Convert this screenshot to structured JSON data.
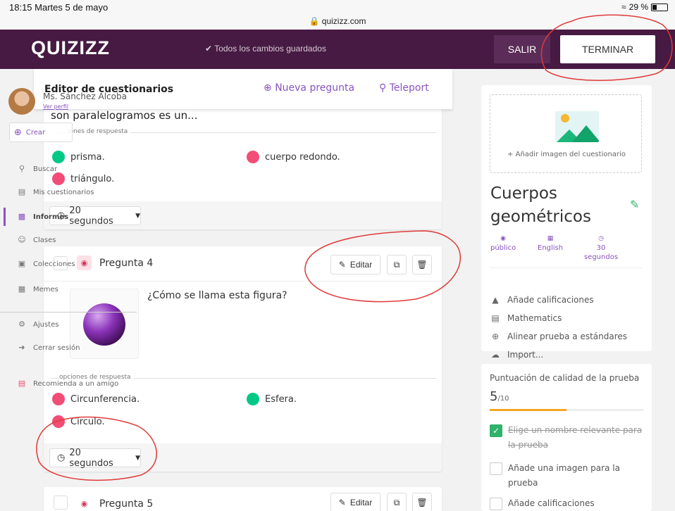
{
  "status_bar": {
    "time": "18:15  Martes 5 de mayo",
    "url": "quizizz.com",
    "battery": "29 %"
  },
  "header": {
    "logo": "QUIZIZZ",
    "saved_status": "Todos los cambios guardados",
    "salir_label": "SALIR",
    "terminar_label": "TERMINAR"
  },
  "editor_bar": {
    "title": "Editor de cuestionarios",
    "nueva_pregunta": "Nueva pregunta",
    "teleport": "Teleport"
  },
  "sidebar": {
    "profile_name": "Ms. Sánchez Alcoba",
    "profile_link": "Ver perfil",
    "crear_label": "Crear",
    "items": [
      {
        "label": "Buscar",
        "icon": "search-icon"
      },
      {
        "label": "Mis cuestionarios",
        "icon": "document-icon"
      },
      {
        "label": "Informes",
        "icon": "bar-chart-icon"
      },
      {
        "label": "Clases",
        "icon": "users-icon"
      },
      {
        "label": "Colecciones",
        "icon": "folder-icon"
      },
      {
        "label": "Memes",
        "icon": "image-icon"
      },
      {
        "label": "Ajustes",
        "icon": "gear-icon"
      },
      {
        "label": "Cerrar sesión",
        "icon": "logout-icon"
      },
      {
        "label": "Recomienda a un amigo",
        "icon": "gift-icon"
      }
    ]
  },
  "question3": {
    "text": "son paralelogramos es un...",
    "options_heading": "iones de respuesta",
    "options": [
      {
        "label": "prisma.",
        "correct": true
      },
      {
        "label": "cuerpo redondo.",
        "correct": false
      },
      {
        "label": "triángulo.",
        "correct": false
      }
    ],
    "time": "20 segundos"
  },
  "question4": {
    "label": "Pregunta 4",
    "text": "¿Cómo se llama esta figura?",
    "edit_label": "Editar",
    "options_heading": "opciones de respuesta",
    "options": [
      {
        "label": "Circunferencia.",
        "correct": false
      },
      {
        "label": "Esfera.",
        "correct": true
      },
      {
        "label": "Círculo.",
        "correct": false
      }
    ],
    "time": "20 segundos"
  },
  "question5": {
    "label": "Pregunta 5",
    "edit_label": "Editar"
  },
  "quiz_panel": {
    "add_image_label": "+ Añadir imagen del cuestionario",
    "title": "Cuerpos geométricos",
    "meta": [
      {
        "label": "público",
        "icon": "eye-icon"
      },
      {
        "label": "English",
        "icon": "language-icon"
      },
      {
        "label": "30 segundos",
        "icon": "clock-icon"
      }
    ],
    "links": [
      {
        "label": "Añade calificaciones",
        "icon": "graduation-cap-icon"
      },
      {
        "label": "Mathematics",
        "icon": "book-icon"
      },
      {
        "label": "Alinear prueba a estándares",
        "icon": "plus-circle-icon"
      },
      {
        "label": "Import...",
        "icon": "cloud-upload-icon"
      }
    ]
  },
  "quality_panel": {
    "label": "Puntuación de calidad de la prueba",
    "score": "5",
    "score_max": "/10",
    "progress_fraction": 0.5,
    "checklist": [
      {
        "label": "Elige un nombre relevante para la prueba",
        "done": true
      },
      {
        "label": "Añade una imagen para la prueba",
        "done": false
      },
      {
        "label": "Añade calificaciones",
        "done": false
      }
    ]
  },
  "colors": {
    "brand": "#461a42",
    "accent": "#8854c0",
    "correct": "#00c985",
    "incorrect": "#f14d76",
    "annotation": "#e03a3a"
  }
}
